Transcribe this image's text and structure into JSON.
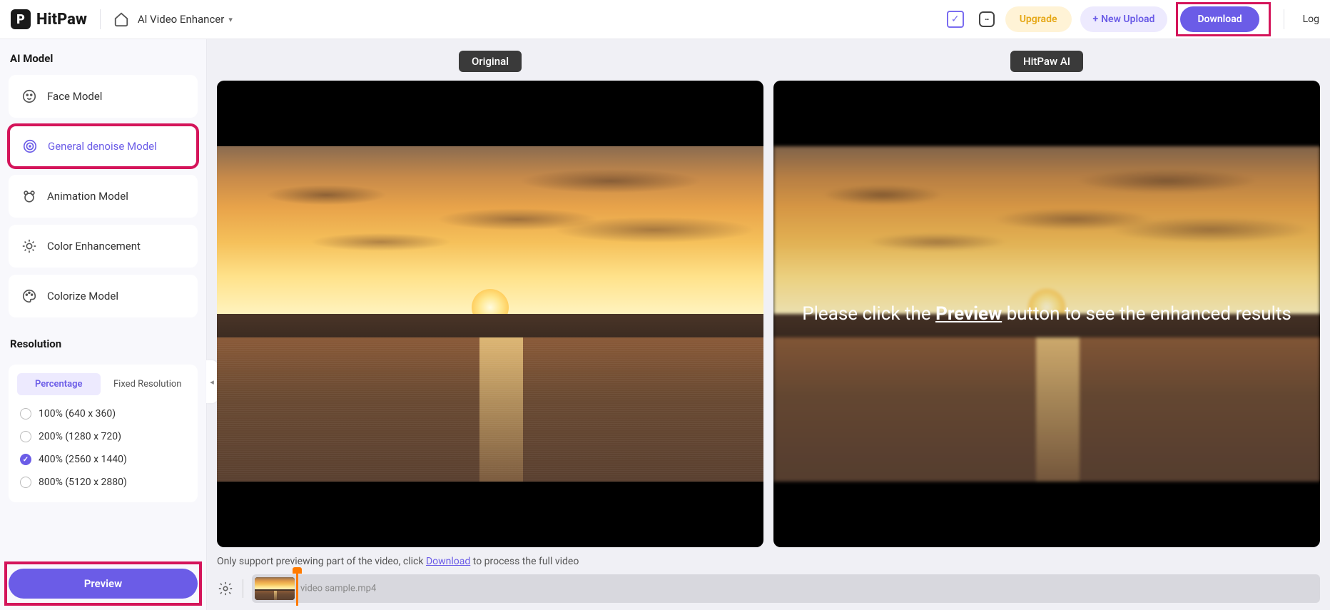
{
  "header": {
    "brand": "HitPaw",
    "app_title": "Al Video Enhancer",
    "upgrade": "Upgrade",
    "new_upload": "New Upload",
    "download": "Download",
    "login": "Log"
  },
  "sidebar": {
    "section_model": "AI Model",
    "models": [
      {
        "name": "Face Model",
        "icon": "face-icon",
        "active": false
      },
      {
        "name": "General denoise Model",
        "icon": "denoise-icon",
        "active": true
      },
      {
        "name": "Animation Model",
        "icon": "bear-icon",
        "active": false
      },
      {
        "name": "Color Enhancement",
        "icon": "sun-icon",
        "active": false
      },
      {
        "name": "Colorize Model",
        "icon": "palette-icon",
        "active": false
      }
    ],
    "section_resolution": "Resolution",
    "res_tabs": {
      "percentage": "Percentage",
      "fixed": "Fixed Resolution"
    },
    "res_options": [
      {
        "label": "100% (640 x 360)",
        "checked": false
      },
      {
        "label": "200% (1280 x 720)",
        "checked": false
      },
      {
        "label": "400% (2560 x 1440)",
        "checked": true
      },
      {
        "label": "800% (5120 x 2880)",
        "checked": false
      }
    ],
    "preview_btn": "Preview"
  },
  "content": {
    "panel_original": "Original",
    "panel_ai": "HitPaw AI",
    "overlay_pre": "Please click the ",
    "overlay_bold": "Preview",
    "overlay_post": " button to see the enhanced results",
    "note_pre": "Only support previewing part of the video, click ",
    "note_link": "Download",
    "note_post": " to process the full video",
    "timeline_filename": "video sample.mp4"
  },
  "colors": {
    "accent": "#6b5ce7",
    "highlight": "#d4145a",
    "upgrade": "#e6a817"
  }
}
